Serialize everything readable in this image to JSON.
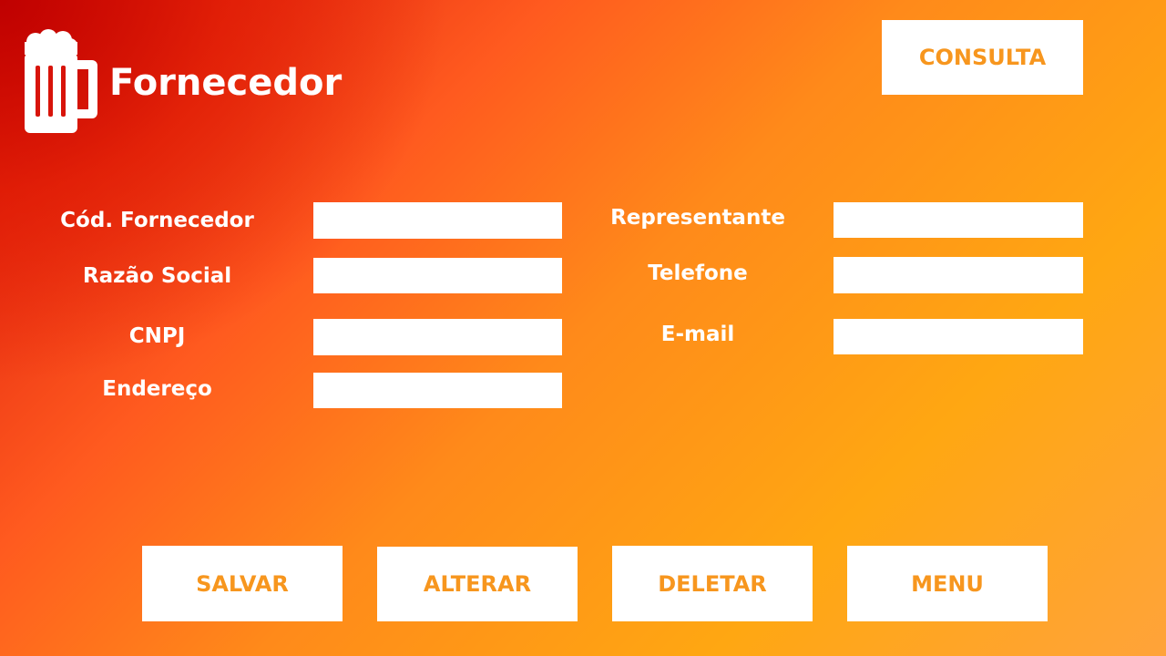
{
  "header": {
    "title": "Fornecedor",
    "logo_icon": "beer-mug-icon",
    "consulta_label": "CONSULTA"
  },
  "form": {
    "codigo": {
      "label": "Cód. Fornecedor",
      "value": ""
    },
    "razao_social": {
      "label": "Razão Social",
      "value": ""
    },
    "cnpj": {
      "label": "CNPJ",
      "value": ""
    },
    "endereco": {
      "label": "Endereço",
      "value": ""
    },
    "representante": {
      "label": "Representante",
      "value": ""
    },
    "telefone": {
      "label": "Telefone",
      "value": ""
    },
    "email": {
      "label": "E-mail",
      "value": ""
    }
  },
  "actions": {
    "salvar": "SALVAR",
    "alterar": "ALTERAR",
    "deletar": "DELETAR",
    "menu": "MENU"
  },
  "colors": {
    "accent": "#f7961e",
    "background_dark": "#d80f08",
    "background_light": "#ffa712",
    "button_bg": "#ffffff",
    "text_light": "#ffffff"
  }
}
